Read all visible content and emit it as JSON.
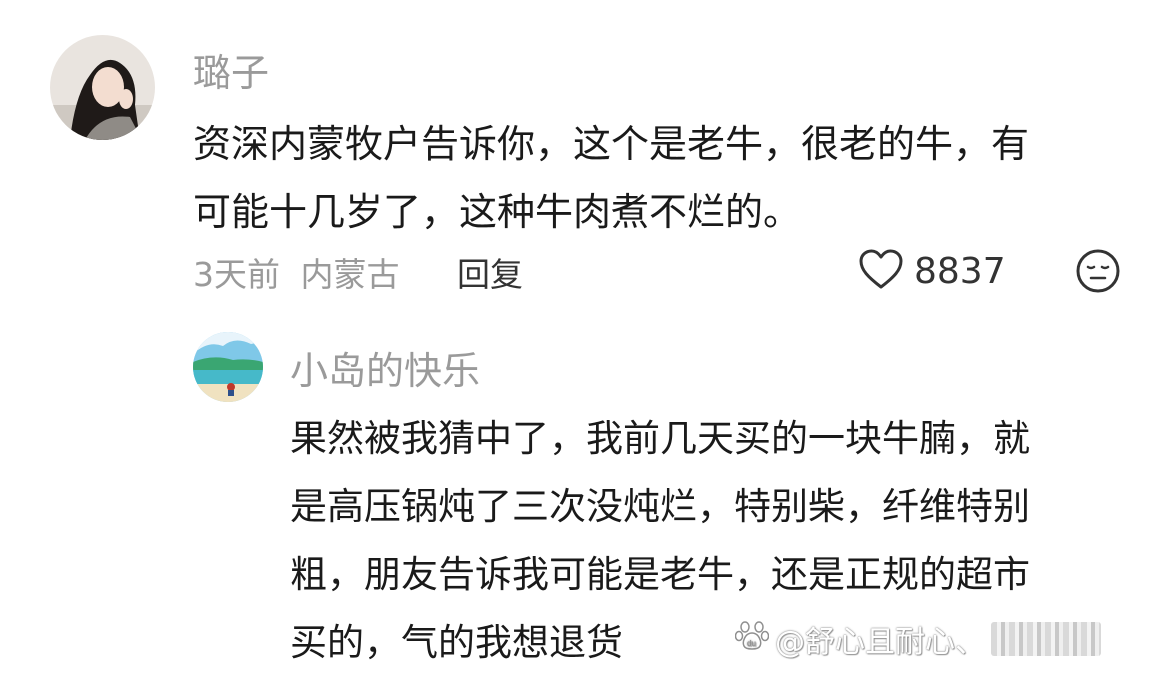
{
  "comment": {
    "username": "璐子",
    "text_lines": [
      "资深内蒙牧户告诉你，这个是老牛，很老的牛，有",
      "可能十几岁了，这种牛肉煮不烂的。"
    ],
    "time": "3天前",
    "location": "内蒙古",
    "reply_label": "回复",
    "like_count": "8837",
    "icons": {
      "like": "heart-icon",
      "dislike": "meh-face-icon"
    }
  },
  "reply": {
    "username": "小岛的快乐",
    "text_lines": [
      "果然被我猜中了，我前几天买的一块牛腩，就",
      "是高压锅炖了三次没炖烂，特别柴，纤维特别",
      "粗，朋友告诉我可能是老牛，还是正规的超市",
      "买的，气的我想退货"
    ]
  },
  "watermark": {
    "text": "@舒心且耐心、",
    "icon": "paw-logo-icon"
  },
  "colors": {
    "meta_gray": "#9a9a9a",
    "text_dark": "#1a1a1a"
  }
}
